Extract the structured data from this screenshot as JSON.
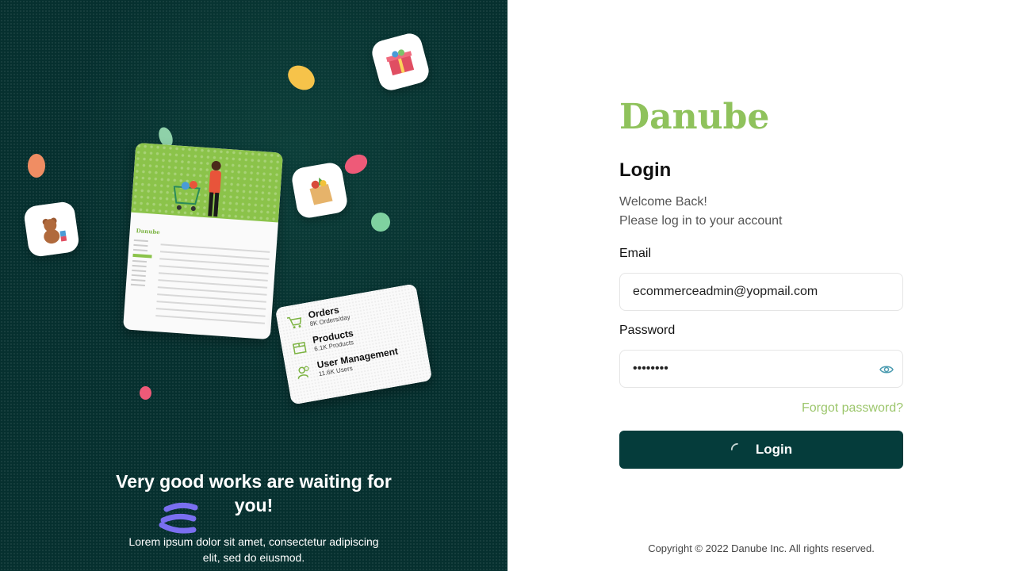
{
  "brand": {
    "name": "Danube",
    "color": "#8fc25c"
  },
  "illustration": {
    "dashboard_brand": "Danube",
    "stats": [
      {
        "icon": "cart-icon",
        "title": "Orders",
        "subtitle": "8K Orders/day"
      },
      {
        "icon": "box-icon",
        "title": "Products",
        "subtitle": "6.1K Products"
      },
      {
        "icon": "users-icon",
        "title": "User Management",
        "subtitle": "11.6K Users"
      }
    ],
    "tiles": [
      "toys-icon",
      "grocery-bag-icon",
      "gift-box-icon"
    ]
  },
  "promo": {
    "headline": "Very good works are waiting for you!",
    "body": "Lorem ipsum dolor sit amet, consectetur adipiscing elit, sed do eiusmod."
  },
  "login": {
    "title": "Login",
    "welcome_line1": "Welcome Back!",
    "welcome_line2": "Please log in to your account",
    "email_label": "Email",
    "email_value": "ecommerceadmin@yopmail.com",
    "password_label": "Password",
    "password_value": "password",
    "forgot_label": "Forgot password?",
    "submit_label": "Login",
    "submit_state": "loading"
  },
  "footer": {
    "copyright": "Copyright © 2022 Danube Inc. All rights reserved."
  },
  "colors": {
    "panel_bg": "#06302f",
    "button_bg": "#053c3b",
    "accent_green": "#8fc25c",
    "link_green": "#9cc66c"
  }
}
